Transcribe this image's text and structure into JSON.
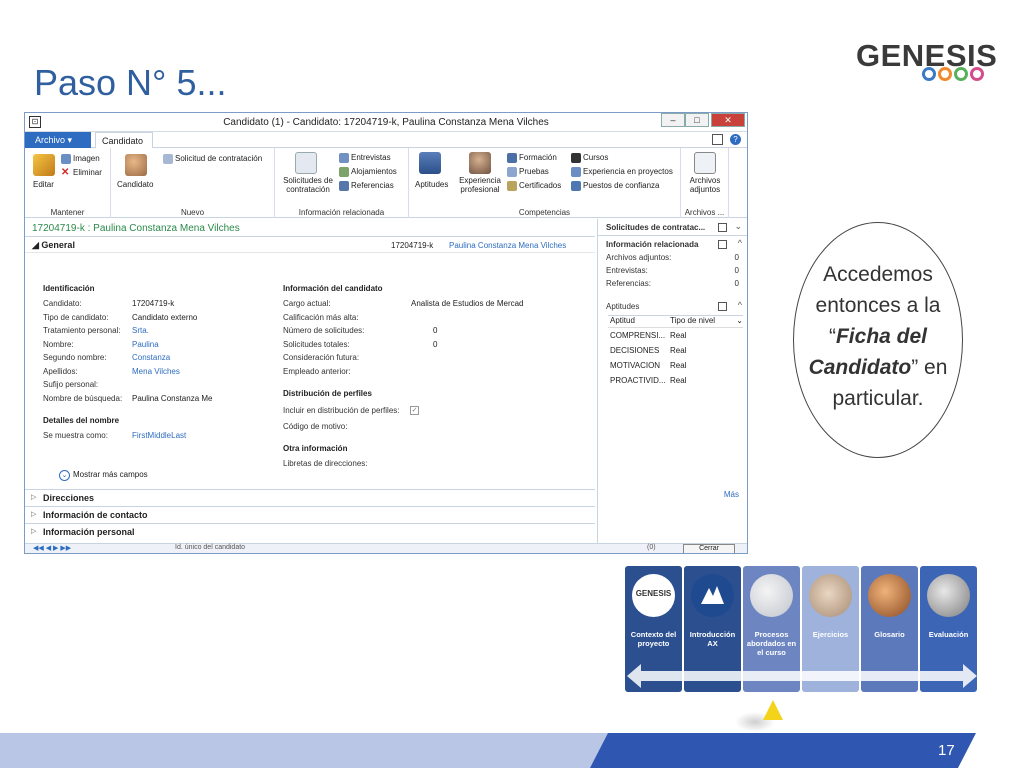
{
  "slide": {
    "title": "Paso N° 5...",
    "logo_text": "GENESIS",
    "page_number": "17",
    "callout": {
      "line1": "Accedemos",
      "line2": "entonces a la",
      "line3_open": "“",
      "line3_em": "Ficha del",
      "line4_em": "Candidato",
      "line4_close": "” en",
      "line5": "particular."
    }
  },
  "window": {
    "title": "Candidato (1) - Candidato: 17204719-k, Paulina Constanza Mena  Vilches",
    "tabs": {
      "archivo": "Archivo ▾",
      "candidato": "Candidato"
    },
    "ribbon": {
      "mantener": {
        "label": "Mantener",
        "editar": "Editar",
        "imagen": "Imagen",
        "eliminar": "Eliminar"
      },
      "nuevo": {
        "label": "Nuevo",
        "candidato": "Candidato",
        "solicitud": "Solicitud de contratación"
      },
      "info": {
        "label": "Información relacionada",
        "solicitudes1": "Solicitudes de",
        "solicitudes2": "contratación",
        "entrevistas": "Entrevistas",
        "alojamientos": "Alojamientos",
        "referencias": "Referencias"
      },
      "competencias": {
        "label": "Competencias",
        "aptitudes": "Aptitudes",
        "experiencia1": "Experiencia",
        "experiencia2": "profesional",
        "formacion": "Formación",
        "pruebas": "Pruebas",
        "certificados": "Certificados",
        "cursos": "Cursos",
        "exp_proyectos": "Experiencia en proyectos",
        "puestos": "Puestos de confianza"
      },
      "archivos": {
        "label": "Archivos ...",
        "b1": "Archivos",
        "b2": "adjuntos"
      }
    },
    "record_header": "17204719-k : Paulina Constanza Mena  Vilches",
    "general": {
      "title": "General",
      "id": "17204719-k",
      "name": "Paulina Constanza Mena  Vilches",
      "identificacion": "Identificación",
      "fields_left": [
        {
          "label": "Candidato:",
          "value": "17204719-k"
        },
        {
          "label": "Tipo de candidato:",
          "value": "Candidato externo"
        },
        {
          "label": "Tratamiento personal:",
          "value": "Srta."
        },
        {
          "label": "Nombre:",
          "value": "Paulina"
        },
        {
          "label": "Segundo nombre:",
          "value": "Constanza"
        },
        {
          "label": "Apellidos:",
          "value": "Mena  Vilches"
        },
        {
          "label": "Sufijo personal:",
          "value": ""
        },
        {
          "label": "Nombre de búsqueda:",
          "value": "Paulina Constanza Me"
        }
      ],
      "detalles": "Detalles del nombre",
      "se_muestra_label": "Se muestra como:",
      "se_muestra_value": "FirstMiddleLast",
      "info_candidato": "Información del candidato",
      "fields_right": [
        {
          "label": "Cargo actual:",
          "value": "Analista de Estudios de Mercad"
        },
        {
          "label": "Calificación más alta:",
          "value": ""
        },
        {
          "label": "Número de solicitudes:",
          "value": "0"
        },
        {
          "label": "Solicitudes totales:",
          "value": "0"
        },
        {
          "label": "Consideración futura:",
          "value": ""
        },
        {
          "label": "Empleado anterior:",
          "value": ""
        }
      ],
      "distribucion": "Distribución de perfiles",
      "incluir": "Incluir en distribución de perfiles:",
      "codigo": "Código de motivo:",
      "otra": "Otra información",
      "libretas": "Libretas de direcciones:",
      "mostrar": "Mostrar más campos"
    },
    "sections": [
      "Direcciones",
      "Información de contacto",
      "Información personal"
    ],
    "factbox": {
      "solicitudes": "Solicitudes de contratac...",
      "info_rel": "Información relacionada",
      "rows": [
        {
          "label": "Archivos adjuntos:",
          "value": "0"
        },
        {
          "label": "Entrevistas:",
          "value": "0"
        },
        {
          "label": "Referencias:",
          "value": "0"
        }
      ],
      "aptitudes": "Aptitudes",
      "col1": "Aptitud",
      "col2": "Tipo de nivel",
      "apt_rows": [
        {
          "a": "COMPRENSI...",
          "t": "Real"
        },
        {
          "a": "DECISIONES",
          "t": "Real"
        },
        {
          "a": "MOTIVACION",
          "t": "Real"
        },
        {
          "a": "PROACTIVID...",
          "t": "Real"
        }
      ],
      "mas": "Más"
    },
    "status": {
      "text": "Id. único del candidato",
      "count": "(0)",
      "cerrar": "Cerrar"
    }
  },
  "nav": [
    {
      "label": "Contexto del proyecto",
      "color": "#2b4f8f"
    },
    {
      "label": "Introducción AX",
      "color": "#2b4f8f"
    },
    {
      "label": "Procesos abordados en el curso",
      "color": "#6d86c2"
    },
    {
      "label": "Ejercicios",
      "color": "#9fb2dc"
    },
    {
      "label": "Glosario",
      "color": "#5c79bb"
    },
    {
      "label": "Evaluación",
      "color": "#3d65b5"
    }
  ],
  "colors": {
    "accent": "#2f5f9e",
    "footer": "#b9c6e6",
    "footer_dark": "#2f56b0"
  }
}
